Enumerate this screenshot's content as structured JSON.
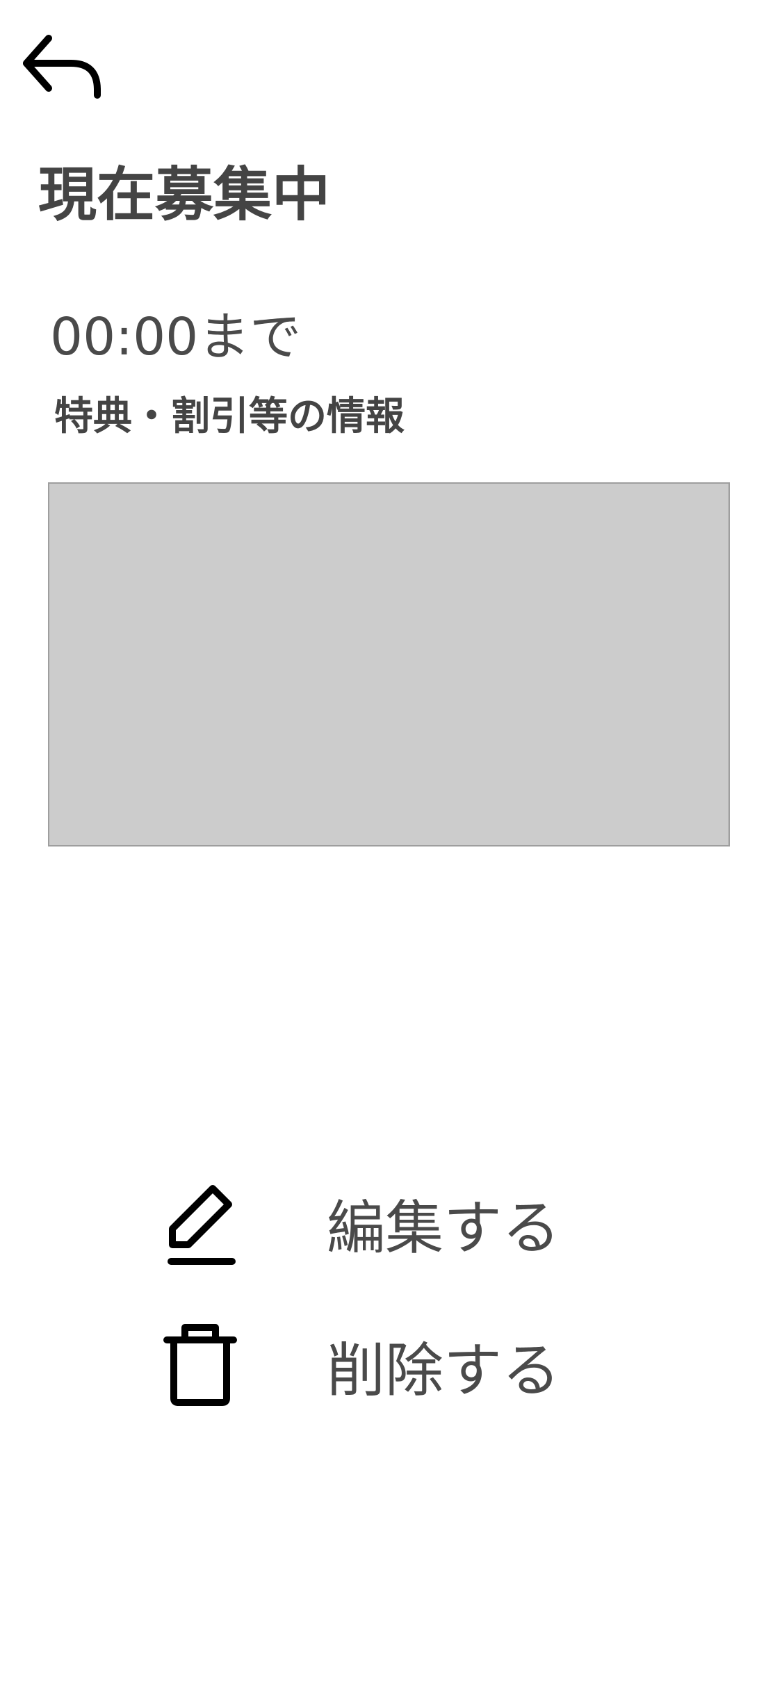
{
  "header": {
    "back_icon": "back-arrow-icon",
    "title": "現在募集中"
  },
  "listing": {
    "deadline": "00:00まで",
    "perk_label": "特典・割引等の情報",
    "image_placeholder_color": "#cccccc"
  },
  "actions": {
    "edit": {
      "icon": "pencil-icon",
      "label": "編集する"
    },
    "delete": {
      "icon": "trash-icon",
      "label": "削除する"
    }
  },
  "colors": {
    "text": "#444444",
    "icon": "#000000",
    "background": "#ffffff"
  }
}
